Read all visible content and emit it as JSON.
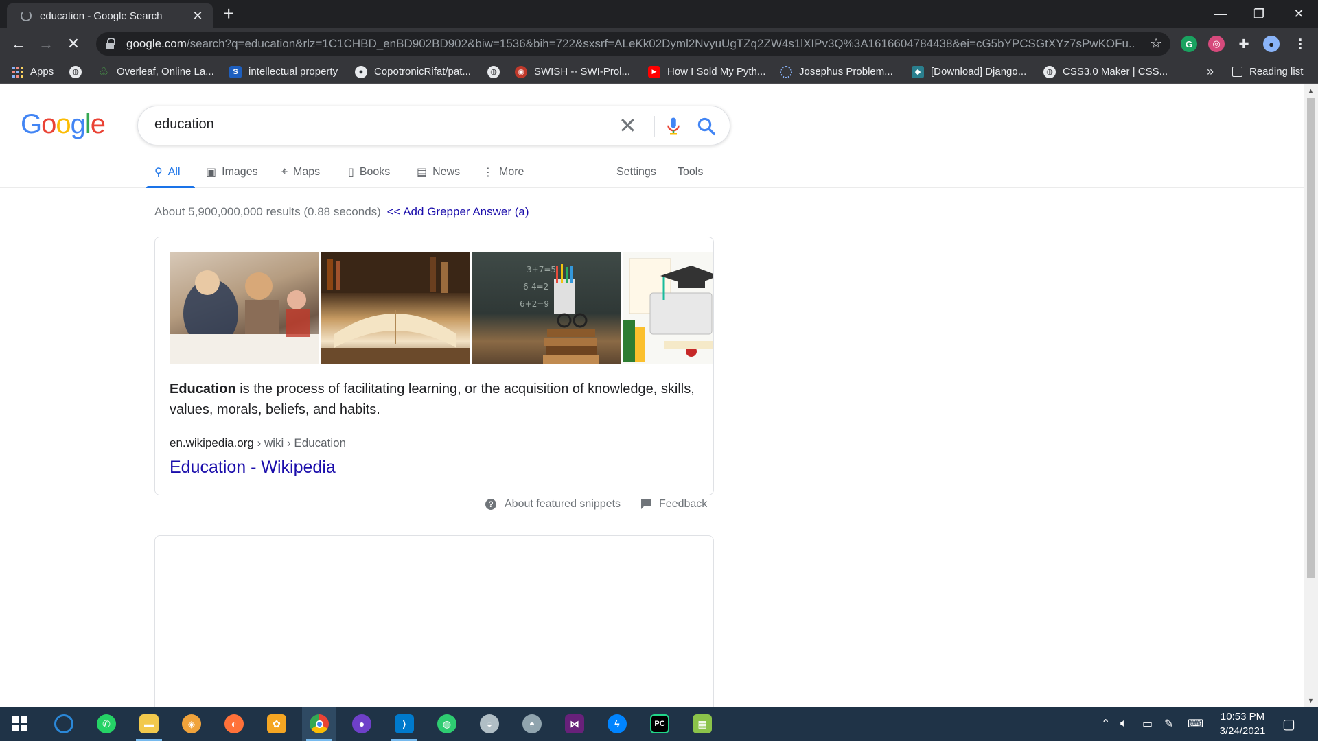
{
  "browser": {
    "tab_title": "education - Google Search",
    "url_host": "google.com",
    "url_rest": "/search?q=education&rlz=1C1CHBD_enBD902BD902&biw=1536&bih=722&sxsrf=ALeKk02Dyml2NvyuUgTZq2ZW4s1lXIPv3Q%3A1616604784438&ei=cG5bYPCSGtXYz7sPwKOFu...",
    "newtab_symbol": "+",
    "bookmarks": [
      {
        "label": "Apps",
        "icon": "apps-grid-icon"
      },
      {
        "label": "",
        "icon": "globe-icon"
      },
      {
        "label": "Overleaf, Online La...",
        "icon": "overleaf-icon"
      },
      {
        "label": "intellectual property",
        "icon": "s-icon"
      },
      {
        "label": "CopotronicRifat/pat...",
        "icon": "github-icon"
      },
      {
        "label": "",
        "icon": "globe-icon"
      },
      {
        "label": "SWISH -- SWI-Prol...",
        "icon": "swish-icon"
      },
      {
        "label": "How I Sold My Pyth...",
        "icon": "youtube-icon"
      },
      {
        "label": "Josephus Problem...",
        "icon": "loading-icon"
      },
      {
        "label": "[Download] Django...",
        "icon": "django-icon"
      },
      {
        "label": "CSS3.0 Maker | CSS...",
        "icon": "globe-icon"
      }
    ],
    "bookmarks_overflow": "»",
    "reading_list": "Reading list"
  },
  "google": {
    "logo_letters": [
      "G",
      "o",
      "o",
      "g",
      "l",
      "e"
    ],
    "query": "education",
    "tabs": [
      {
        "label": "All",
        "icon": "search-icon",
        "active": true
      },
      {
        "label": "Images",
        "icon": "image-icon"
      },
      {
        "label": "Maps",
        "icon": "map-pin-icon"
      },
      {
        "label": "Books",
        "icon": "book-icon"
      },
      {
        "label": "News",
        "icon": "news-icon"
      },
      {
        "label": "More",
        "icon": "more-vert-icon"
      }
    ],
    "settings_label": "Settings",
    "tools_label": "Tools",
    "stats": "About 5,900,000,000 results (0.88 seconds)",
    "grepper": "<< Add Grepper Answer (a)",
    "snippet": {
      "term": "Education",
      "text": " is the process of facilitating learning, or the acquisition of knowledge, skills, values, morals, beliefs, and habits.",
      "site": "en.wikipedia.org",
      "crumb": " › wiki › Education",
      "title": "Education - Wikipedia"
    },
    "about_snippets": "About featured snippets",
    "feedback": "Feedback"
  },
  "taskbar": {
    "time": "10:53 PM",
    "date": "3/24/2021"
  },
  "colors": {
    "link": "#1a0dab",
    "accent": "#1a73e8",
    "chrome_dark": "#202124",
    "taskbar": "#1f3347"
  }
}
